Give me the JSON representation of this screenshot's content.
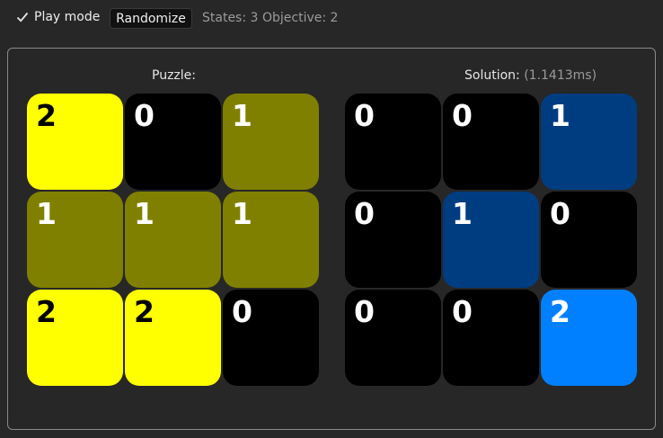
{
  "toolbar": {
    "play_mode_label": "Play mode",
    "play_mode_checked": true,
    "randomize_label": "Randomize",
    "states_text": "States: 3",
    "objective_text": "Objective: 2"
  },
  "puzzle": {
    "title": "Puzzle:",
    "cells": [
      {
        "value": "2",
        "color": "#ffff00",
        "text_color": "#000000"
      },
      {
        "value": "0",
        "color": "#000000",
        "text_color": "#ffffff"
      },
      {
        "value": "1",
        "color": "#808000",
        "text_color": "#ffffff"
      },
      {
        "value": "1",
        "color": "#808000",
        "text_color": "#ffffff"
      },
      {
        "value": "1",
        "color": "#808000",
        "text_color": "#ffffff"
      },
      {
        "value": "1",
        "color": "#808000",
        "text_color": "#ffffff"
      },
      {
        "value": "2",
        "color": "#ffff00",
        "text_color": "#000000"
      },
      {
        "value": "2",
        "color": "#ffff00",
        "text_color": "#000000"
      },
      {
        "value": "0",
        "color": "#000000",
        "text_color": "#ffffff"
      }
    ]
  },
  "solution": {
    "title": "Solution:",
    "timing": "(1.1413ms)",
    "cells": [
      {
        "value": "0",
        "color": "#000000",
        "text_color": "#ffffff"
      },
      {
        "value": "0",
        "color": "#000000",
        "text_color": "#ffffff"
      },
      {
        "value": "1",
        "color": "#003d80",
        "text_color": "#ffffff"
      },
      {
        "value": "0",
        "color": "#000000",
        "text_color": "#ffffff"
      },
      {
        "value": "1",
        "color": "#003d80",
        "text_color": "#ffffff"
      },
      {
        "value": "0",
        "color": "#000000",
        "text_color": "#ffffff"
      },
      {
        "value": "0",
        "color": "#000000",
        "text_color": "#ffffff"
      },
      {
        "value": "0",
        "color": "#000000",
        "text_color": "#ffffff"
      },
      {
        "value": "2",
        "color": "#0080ff",
        "text_color": "#ffffff"
      }
    ]
  }
}
